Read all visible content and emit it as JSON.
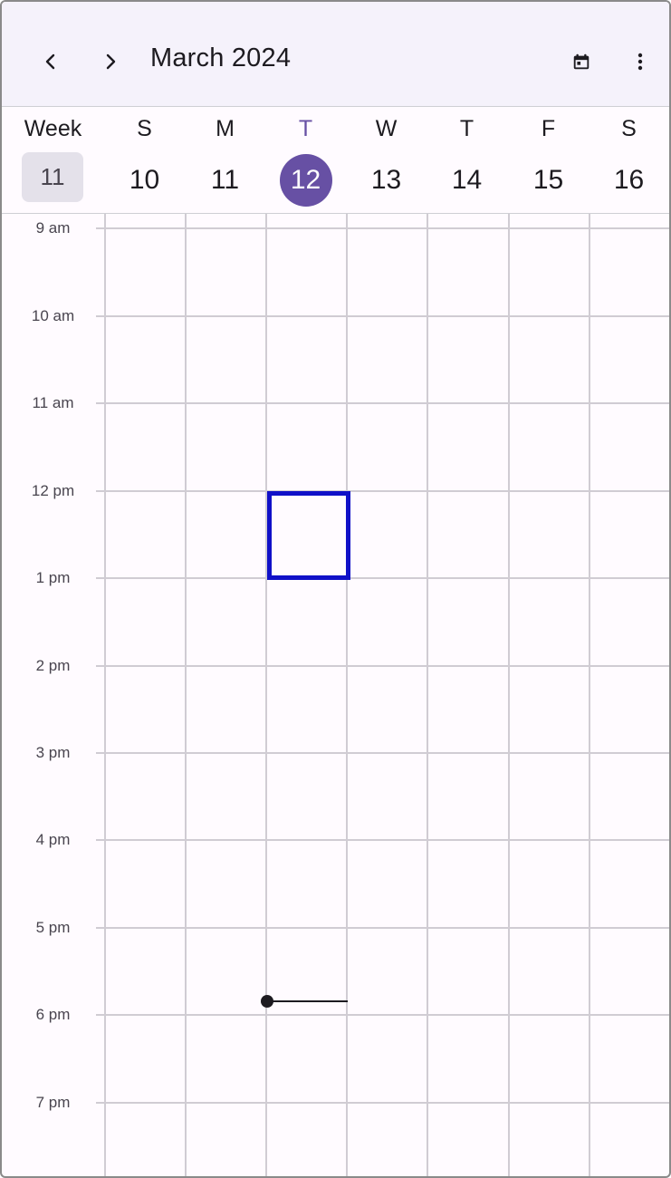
{
  "appbar": {
    "title": "March 2024",
    "icons": [
      "chevron-left-icon",
      "chevron-right-icon",
      "calendar-today-icon",
      "more-vert-icon"
    ]
  },
  "week": {
    "label": "Week",
    "number": "11",
    "days": [
      {
        "name": "S",
        "num": "10"
      },
      {
        "name": "M",
        "num": "11"
      },
      {
        "name": "T",
        "num": "12",
        "today": true
      },
      {
        "name": "W",
        "num": "13"
      },
      {
        "name": "T",
        "num": "14"
      },
      {
        "name": "F",
        "num": "15"
      },
      {
        "name": "S",
        "num": "16"
      }
    ]
  },
  "times": [
    "9 am",
    "10 am",
    "11 am",
    "12 pm",
    "1 pm",
    "2 pm",
    "3 pm",
    "4 pm",
    "5 pm",
    "6 pm",
    "7 pm"
  ],
  "colors": {
    "accent": "#6750a4",
    "selection": "#1010c8",
    "appbar_bg": "#f5f2fb",
    "grid_line": "#d0ccd3"
  }
}
